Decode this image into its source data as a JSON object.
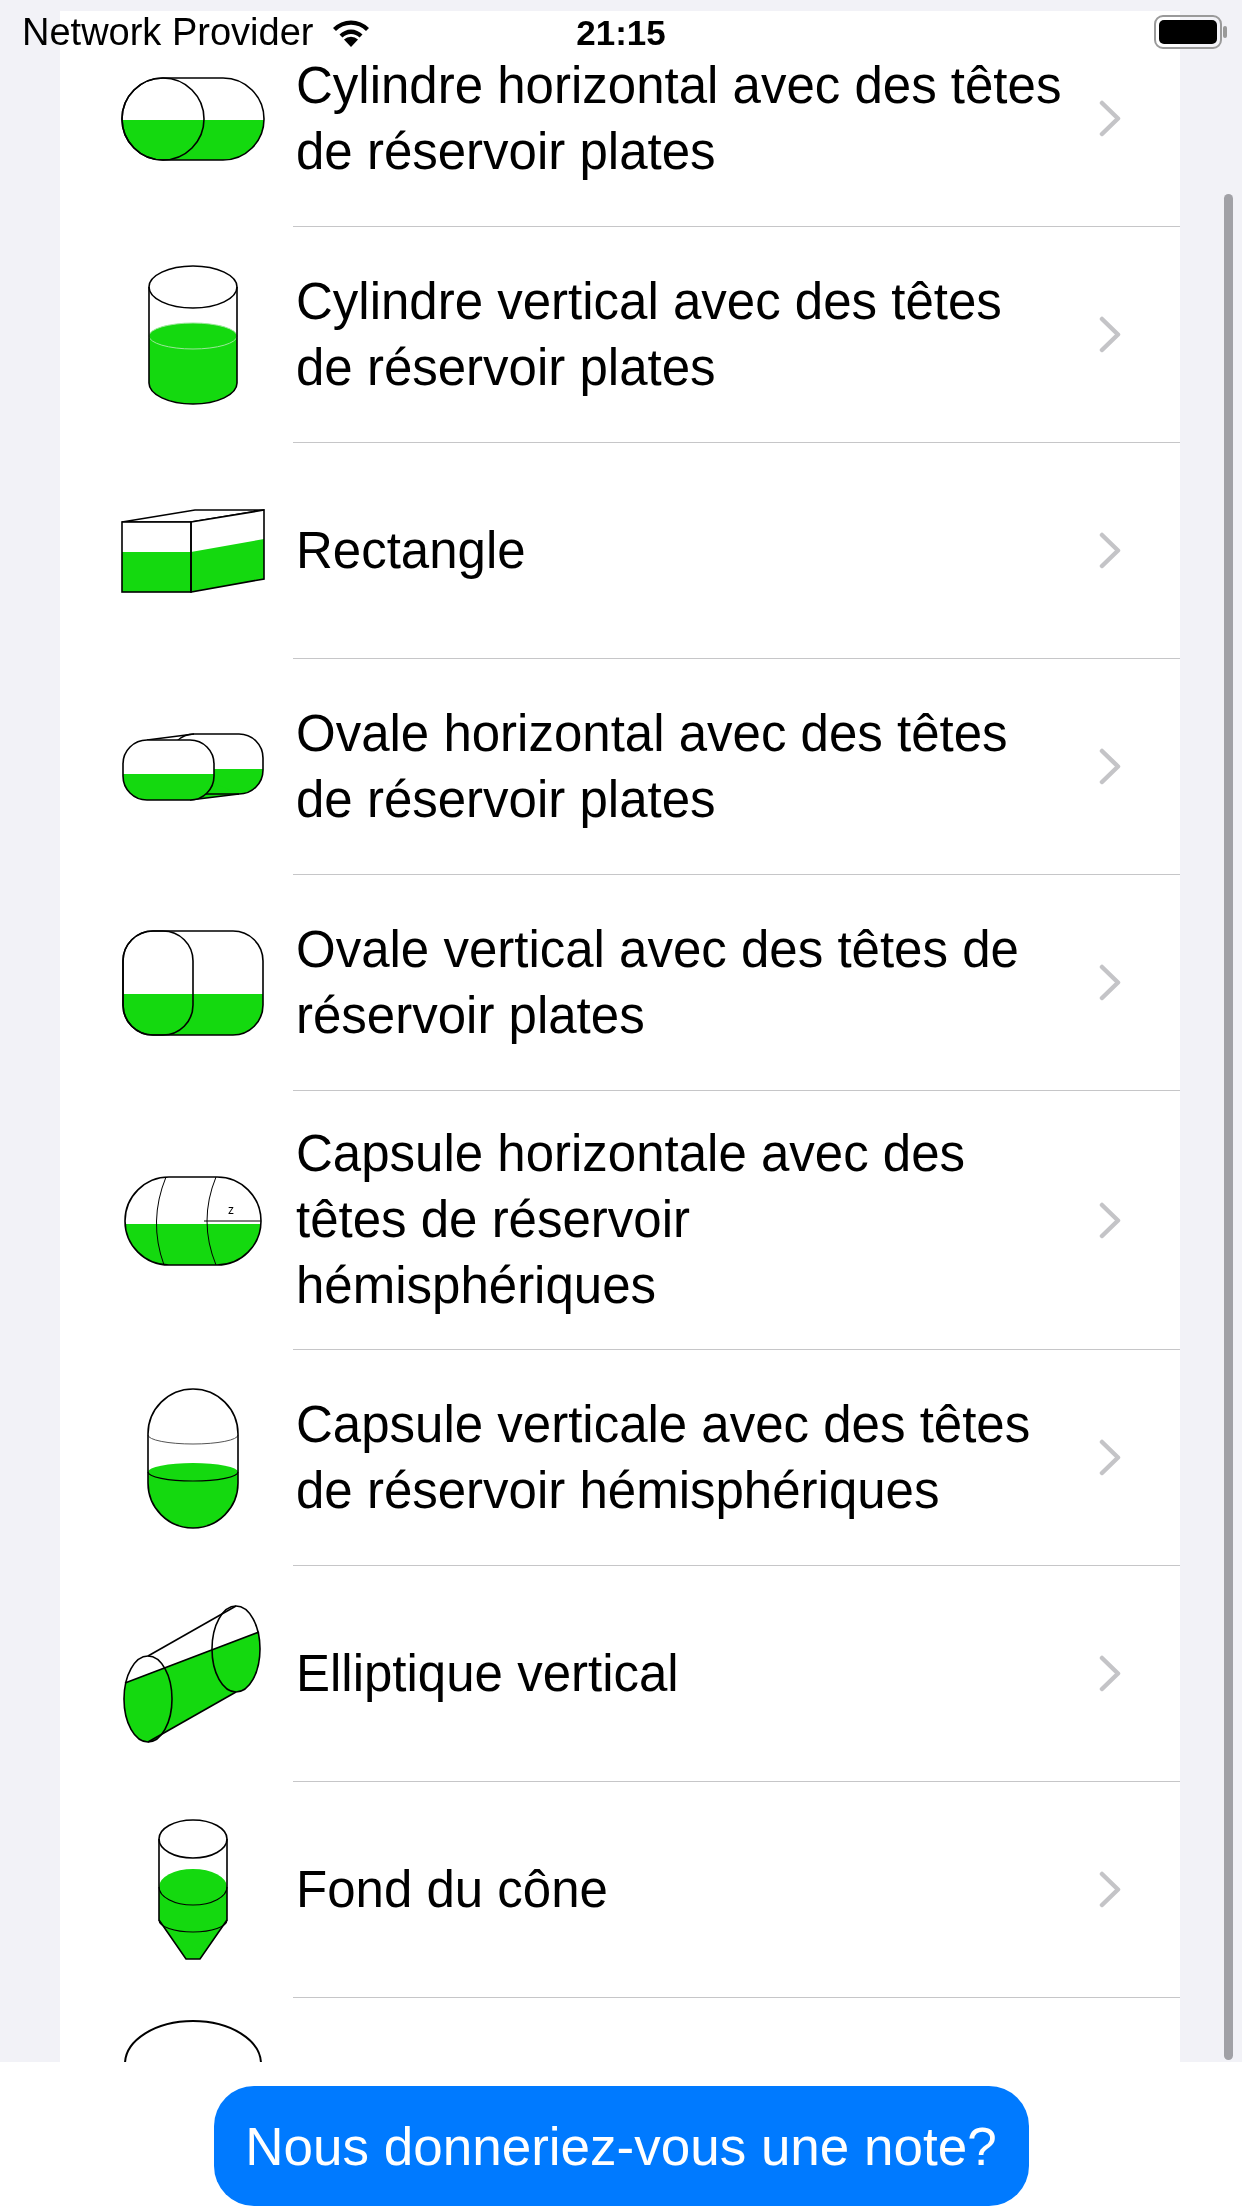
{
  "status_bar": {
    "carrier": "Network Provider",
    "time": "21:15"
  },
  "tanks": [
    {
      "kind": "horizontal-cylinder",
      "lines": [
        "Cylindre horizontal avec des têtes",
        "de réservoir plates"
      ]
    },
    {
      "kind": "vertical-cylinder",
      "lines": [
        "Cylindre vertical avec des têtes",
        "de réservoir plates"
      ]
    },
    {
      "kind": "box",
      "lines": [
        "Rectangle"
      ]
    },
    {
      "kind": "horizontal-oval",
      "lines": [
        "Ovale horizontal avec des têtes",
        "de réservoir plates"
      ]
    },
    {
      "kind": "vertical-oval",
      "lines": [
        "Ovale vertical avec des têtes de",
        "réservoir plates"
      ]
    },
    {
      "kind": "horizontal-capsule",
      "annotation": "z",
      "lines": [
        "Capsule horizontale avec des",
        "têtes de réservoir",
        "hémisphériques"
      ]
    },
    {
      "kind": "vertical-capsule",
      "lines": [
        "Capsule verticale avec des têtes",
        "de réservoir hémisphériques"
      ]
    },
    {
      "kind": "slanted-elliptic",
      "lines": [
        "Elliptique vertical"
      ]
    },
    {
      "kind": "cone-bottom",
      "lines": [
        "Fond du cône"
      ]
    },
    {
      "kind": "cut-off-ellipse"
    }
  ],
  "rating_button": {
    "label": "Nous donneriez-vous une note?"
  }
}
